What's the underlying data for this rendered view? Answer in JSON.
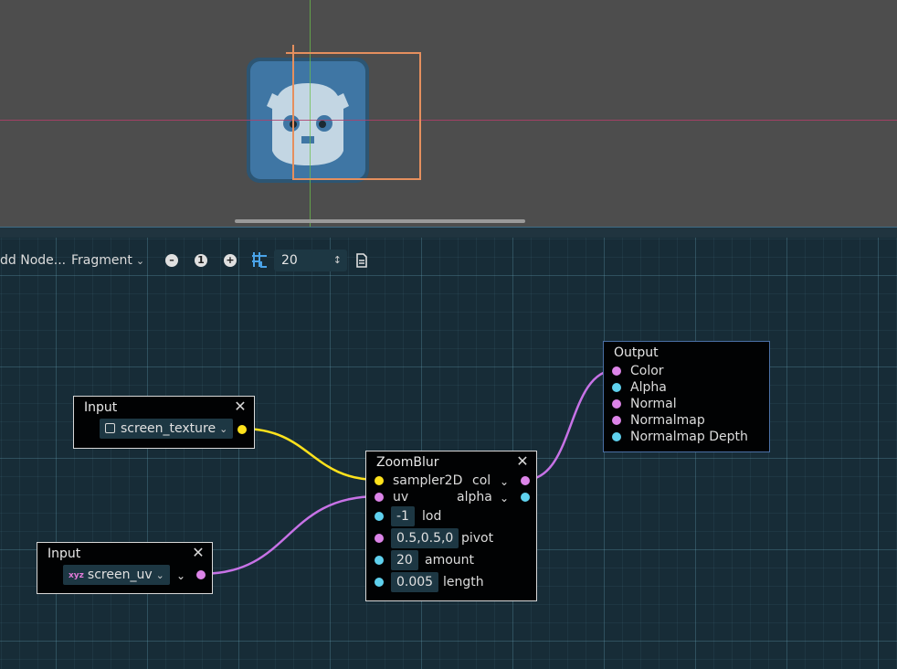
{
  "toolbar": {
    "add_node_label": "dd Node...",
    "shader_mode": "Fragment",
    "zoom_out_icon": "minus-circle-icon",
    "zoom_reset_label": "1",
    "zoom_in_icon": "plus-circle-icon",
    "snap_icon": "grid-snap-icon",
    "snap_value": "20",
    "snap_arrows": "⌃⌄",
    "preview_icon": "document-icon"
  },
  "nodes": {
    "input_texture": {
      "title": "Input",
      "close": "✕",
      "value": "screen_texture"
    },
    "input_uv": {
      "title": "Input",
      "close": "✕",
      "value": "screen_uv"
    },
    "zoomblur": {
      "title": "ZoomBlur",
      "close": "✕",
      "in_sampler": "sampler2D",
      "in_uv": "uv",
      "out_col": "col",
      "out_alpha": "alpha",
      "lod_value": "-1",
      "lod_label": "lod",
      "pivot_value": "0.5,0.5,0",
      "pivot_label": "pivot",
      "amount_value": "20",
      "amount_label": "amount",
      "length_value": "0.005",
      "length_label": "length"
    },
    "output": {
      "title": "Output",
      "ports": [
        "Color",
        "Alpha",
        "Normal",
        "Normalmap",
        "Normalmap Depth"
      ]
    }
  },
  "colors": {
    "sampler_port": "#ffe21c",
    "vector_port": "#dc84e8",
    "scalar_port": "#5fd1ee",
    "texture_wire": "#ffe21c",
    "vector_wire": "#c772e6"
  }
}
